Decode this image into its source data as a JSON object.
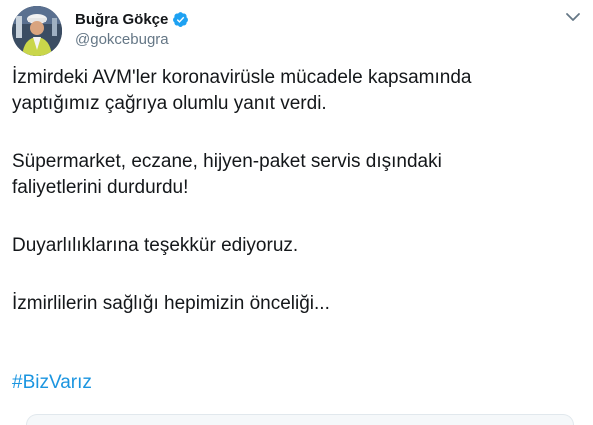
{
  "author": {
    "display_name": "Buğra Gökçe",
    "handle": "@gokcebugra",
    "verified": true,
    "avatar_icon": "profile-photo-icon"
  },
  "menu": {
    "icon": "chevron-down-icon"
  },
  "tweet": {
    "paragraphs": [
      "İzmirdeki AVM'ler koronavirüsle mücadele kapsamında\nyaptığımız çağrıya olumlu yanıt verdi.",
      "Süpermarket, eczane, hijyen-paket servis dışındaki\nfaliyetlerini durdurdu!",
      "Duyarlılıklarına teşekkür ediyoruz.",
      "İzmirlilerin sağlığı hepimizin önceliği..."
    ],
    "hashtag": "#BizVarız"
  },
  "colors": {
    "text": "#14171a",
    "secondary": "#657786",
    "link": "#1b95e0",
    "verified": "#1da1f2"
  }
}
